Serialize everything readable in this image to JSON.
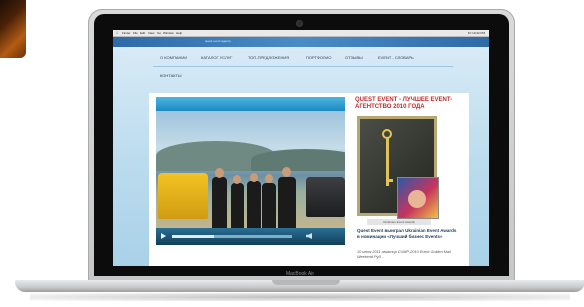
{
  "mac_menubar": {
    "apple_icon": "apple-icon",
    "menus": [
      "Finder",
      "File",
      "Edit",
      "View",
      "Go",
      "Window",
      "Help"
    ],
    "status_text": "Fri 10:42 PM"
  },
  "site": {
    "tagline": "quest event agency",
    "nav": [
      "О КОМПАНИИ",
      "КАТАЛОГ УСЛУГ",
      "ТОП-ПРЕДЛОЖЕНИЯ",
      "ПОРТФОЛИО",
      "ОТЗЫВЫ",
      "EVENT - СЛОВАРЬ"
    ],
    "nav_second": "КОНТАКТЫ",
    "video": {
      "play_icon": "play-icon",
      "volume_icon": "volume-icon",
      "progress": 0.35
    },
    "sidebar": {
      "title": "QUEST EVENT - ЛУЧШЕЕ EVENT-АГЕНТСТВО 2010 ГОДА",
      "image_caption": "Ukrainian Event Awards",
      "news_title": "Quest Event выиграл Ukrainian Event Awards в номинации «Лучший бизнес Events»",
      "news_date": "10 июня 2011 эвкатор CUMP-2010 Event Golden Mail Weekend Руд..."
    }
  },
  "device": {
    "brand": "MacBook Air"
  },
  "colors": {
    "accent": "#c02a2a",
    "nav_text": "#2a3f55",
    "header_blue": "#2e6aa8"
  }
}
